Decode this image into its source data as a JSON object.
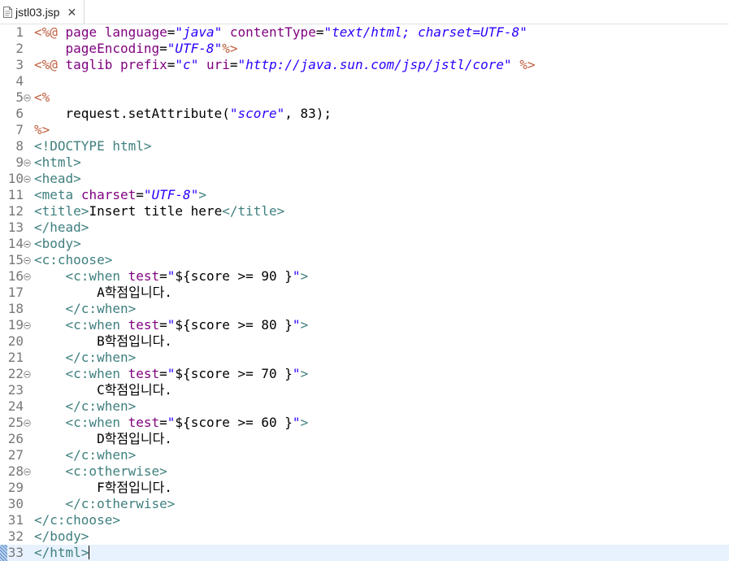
{
  "tab": {
    "title": "jstl03.jsp",
    "icon": "jsp-file-icon",
    "close_label": "✕"
  },
  "colors": {
    "jsp_delimiter": "#bf5f3f",
    "tag": "#3f7f7f",
    "attr": "#7f007f",
    "value": "#2a00ff",
    "text": "#000000",
    "line_number": "#787878",
    "current_line": "#e8f2fe"
  },
  "editor": {
    "current_line": 33,
    "lines": [
      {
        "n": "1",
        "tokens": [
          [
            "jd",
            "<%@"
          ],
          [
            "t",
            " "
          ],
          [
            "a",
            "page"
          ],
          [
            "t",
            " "
          ],
          [
            "a",
            "language"
          ],
          [
            "t",
            "="
          ],
          [
            "v",
            "\"java\""
          ],
          [
            "t",
            " "
          ],
          [
            "a",
            "contentType"
          ],
          [
            "t",
            "="
          ],
          [
            "v",
            "\"text/html; charset=UTF-8\""
          ]
        ]
      },
      {
        "n": "2",
        "tokens": [
          [
            "t",
            "    "
          ],
          [
            "a",
            "pageEncoding"
          ],
          [
            "t",
            "="
          ],
          [
            "v",
            "\"UTF-8\""
          ],
          [
            "jd",
            "%>"
          ]
        ]
      },
      {
        "n": "3",
        "tokens": [
          [
            "jd",
            "<%@"
          ],
          [
            "t",
            " "
          ],
          [
            "a",
            "taglib"
          ],
          [
            "t",
            " "
          ],
          [
            "a",
            "prefix"
          ],
          [
            "t",
            "="
          ],
          [
            "v",
            "\"c\""
          ],
          [
            "t",
            " "
          ],
          [
            "a",
            "uri"
          ],
          [
            "t",
            "="
          ],
          [
            "v",
            "\"http://java.sun.com/jsp/jstl/core\""
          ],
          [
            "t",
            " "
          ],
          [
            "jd",
            "%>"
          ]
        ]
      },
      {
        "n": "4",
        "tokens": []
      },
      {
        "n": "5",
        "fold": true,
        "tokens": [
          [
            "jd",
            "<%"
          ]
        ]
      },
      {
        "n": "6",
        "tokens": [
          [
            "t",
            "    request.setAttribute("
          ],
          [
            "v",
            "\"score\""
          ],
          [
            "t",
            ", 83);"
          ]
        ]
      },
      {
        "n": "7",
        "tokens": [
          [
            "jd",
            "%>"
          ]
        ]
      },
      {
        "n": "8",
        "tokens": [
          [
            "g",
            "<!DOCTYPE html>"
          ]
        ]
      },
      {
        "n": "9",
        "fold": true,
        "tokens": [
          [
            "g",
            "<html>"
          ]
        ]
      },
      {
        "n": "10",
        "fold": true,
        "tokens": [
          [
            "g",
            "<head>"
          ]
        ]
      },
      {
        "n": "11",
        "tokens": [
          [
            "g",
            "<meta"
          ],
          [
            "t",
            " "
          ],
          [
            "a",
            "charset"
          ],
          [
            "t",
            "="
          ],
          [
            "v",
            "\"UTF-8\""
          ],
          [
            "g",
            ">"
          ]
        ]
      },
      {
        "n": "12",
        "tokens": [
          [
            "g",
            "<title>"
          ],
          [
            "t",
            "Insert title here"
          ],
          [
            "g",
            "</title>"
          ]
        ]
      },
      {
        "n": "13",
        "tokens": [
          [
            "g",
            "</head>"
          ]
        ]
      },
      {
        "n": "14",
        "fold": true,
        "tokens": [
          [
            "g",
            "<body>"
          ]
        ]
      },
      {
        "n": "15",
        "fold": true,
        "tokens": [
          [
            "g",
            "<c:choose>"
          ]
        ]
      },
      {
        "n": "16",
        "fold": true,
        "tokens": [
          [
            "t",
            "    "
          ],
          [
            "g",
            "<c:when"
          ],
          [
            "t",
            " "
          ],
          [
            "a",
            "test"
          ],
          [
            "t",
            "="
          ],
          [
            "v",
            "\""
          ],
          [
            "t",
            "${score >= 90 }"
          ],
          [
            "v",
            "\""
          ],
          [
            "g",
            ">"
          ]
        ]
      },
      {
        "n": "17",
        "tokens": [
          [
            "t",
            "        A학점입니다."
          ]
        ]
      },
      {
        "n": "18",
        "tokens": [
          [
            "t",
            "    "
          ],
          [
            "g",
            "</c:when>"
          ]
        ]
      },
      {
        "n": "19",
        "fold": true,
        "tokens": [
          [
            "t",
            "    "
          ],
          [
            "g",
            "<c:when"
          ],
          [
            "t",
            " "
          ],
          [
            "a",
            "test"
          ],
          [
            "t",
            "="
          ],
          [
            "v",
            "\""
          ],
          [
            "t",
            "${score >= 80 }"
          ],
          [
            "v",
            "\""
          ],
          [
            "g",
            ">"
          ]
        ]
      },
      {
        "n": "20",
        "tokens": [
          [
            "t",
            "        B학점입니다."
          ]
        ]
      },
      {
        "n": "21",
        "tokens": [
          [
            "t",
            "    "
          ],
          [
            "g",
            "</c:when>"
          ]
        ]
      },
      {
        "n": "22",
        "fold": true,
        "tokens": [
          [
            "t",
            "    "
          ],
          [
            "g",
            "<c:when"
          ],
          [
            "t",
            " "
          ],
          [
            "a",
            "test"
          ],
          [
            "t",
            "="
          ],
          [
            "v",
            "\""
          ],
          [
            "t",
            "${score >= 70 }"
          ],
          [
            "v",
            "\""
          ],
          [
            "g",
            ">"
          ]
        ]
      },
      {
        "n": "23",
        "tokens": [
          [
            "t",
            "        C학점입니다."
          ]
        ]
      },
      {
        "n": "24",
        "tokens": [
          [
            "t",
            "    "
          ],
          [
            "g",
            "</c:when>"
          ]
        ]
      },
      {
        "n": "25",
        "fold": true,
        "tokens": [
          [
            "t",
            "    "
          ],
          [
            "g",
            "<c:when"
          ],
          [
            "t",
            " "
          ],
          [
            "a",
            "test"
          ],
          [
            "t",
            "="
          ],
          [
            "v",
            "\""
          ],
          [
            "t",
            "${score >= 60 }"
          ],
          [
            "v",
            "\""
          ],
          [
            "g",
            ">"
          ]
        ]
      },
      {
        "n": "26",
        "tokens": [
          [
            "t",
            "        D학점입니다."
          ]
        ]
      },
      {
        "n": "27",
        "tokens": [
          [
            "t",
            "    "
          ],
          [
            "g",
            "</c:when>"
          ]
        ]
      },
      {
        "n": "28",
        "fold": true,
        "tokens": [
          [
            "t",
            "    "
          ],
          [
            "g",
            "<c:otherwise>"
          ]
        ]
      },
      {
        "n": "29",
        "tokens": [
          [
            "t",
            "        F학점입니다."
          ]
        ]
      },
      {
        "n": "30",
        "tokens": [
          [
            "t",
            "    "
          ],
          [
            "g",
            "</c:otherwise>"
          ]
        ]
      },
      {
        "n": "31",
        "tokens": [
          [
            "g",
            "</c:choose>"
          ]
        ]
      },
      {
        "n": "32",
        "tokens": [
          [
            "g",
            "</body>"
          ]
        ]
      },
      {
        "n": "33",
        "tokens": [
          [
            "g",
            "</html>"
          ]
        ],
        "caret": true
      }
    ]
  }
}
